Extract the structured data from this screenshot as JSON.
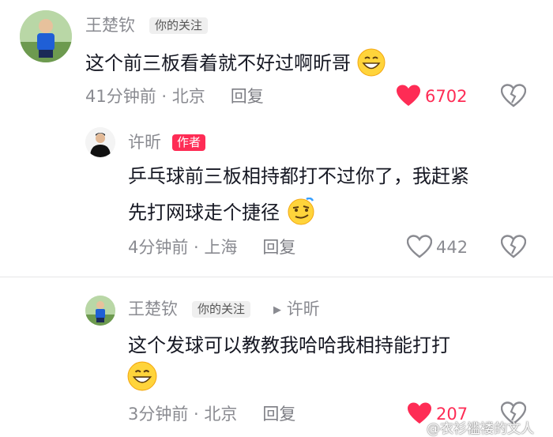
{
  "comments": [
    {
      "author": "王楚钦",
      "tag": "你的关注",
      "text": "这个前三板看着就不好过啊昕哥",
      "emoji": "grin-emoji",
      "time": "41分钟前",
      "location": "北京",
      "reply_label": "回复",
      "likes": "6702",
      "liked": true
    },
    {
      "author": "许昕",
      "tag": "作者",
      "text_lines": [
        "乒乓球前三板相持都打不过你了，我赶紧",
        "先打网球走个捷径"
      ],
      "emoji": "smirk-emoji",
      "time": "4分钟前",
      "location": "上海",
      "reply_label": "回复",
      "likes": "442",
      "liked": false
    },
    {
      "author": "王楚钦",
      "tag": "你的关注",
      "reply_to_arrow": "▶",
      "reply_to": "许昕",
      "text": "这个发球可以教教我哈哈我相持能打打",
      "emoji": "grin-emoji",
      "time": "3分钟前",
      "location": "北京",
      "reply_label": "回复",
      "likes": "207",
      "liked": true
    }
  ],
  "separator": " · ",
  "watermark": "@衣衫褴褛的文人",
  "colors": {
    "accent": "#fe2c55",
    "secondary_text": "#8a8b91",
    "tag_bg": "#efefef"
  }
}
